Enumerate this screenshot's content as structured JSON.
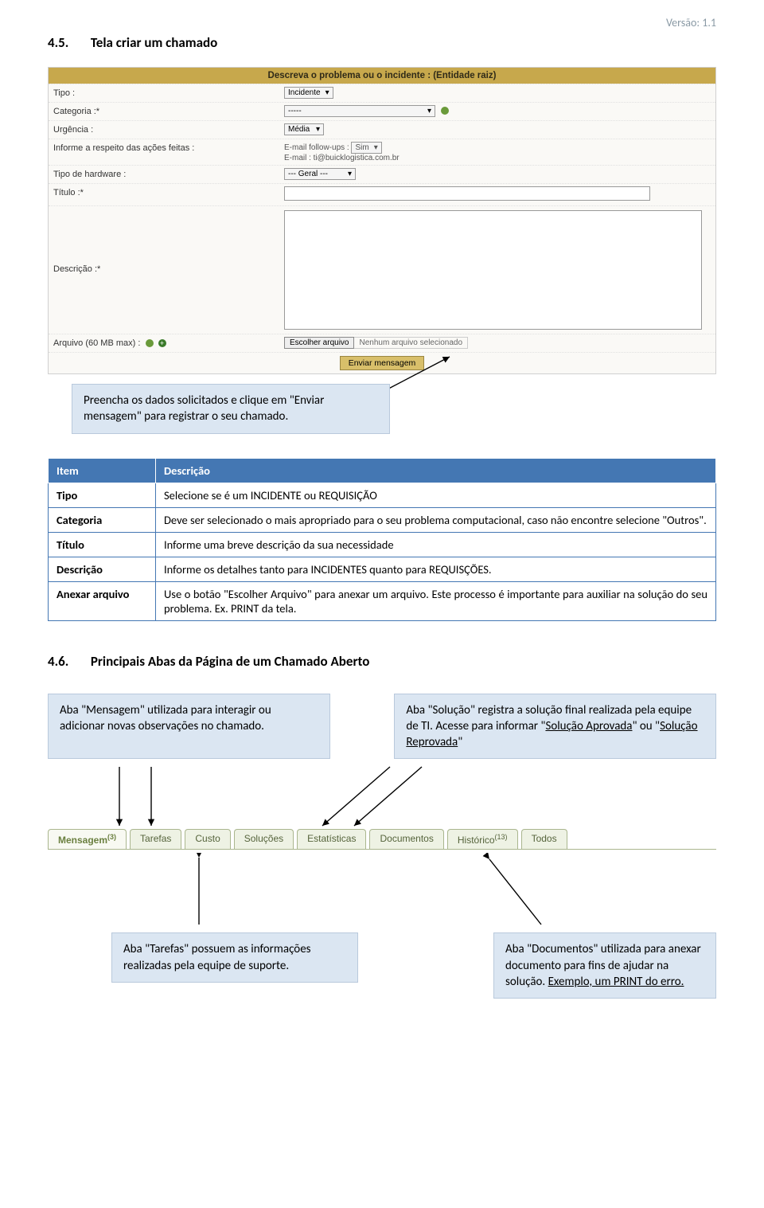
{
  "version_label": "Versão: 1.1",
  "section45_num": "4.5.",
  "section45_title": "Tela criar um chamado",
  "glpi": {
    "header": "Descreva o problema ou o incidente :  (Entidade raiz)",
    "tipo_label": "Tipo :",
    "tipo_value": "Incidente",
    "categoria_label": "Categoria :*",
    "categoria_value": "-----",
    "urgencia_label": "Urgência :",
    "urgencia_value": "Média",
    "info_label": "Informe a respeito das ações feitas :",
    "followup_line": "E-mail follow-ups :",
    "followup_value": "Sim",
    "email_line": "E-mail : ti@buicklogistica.com.br",
    "hw_label": "Tipo de hardware :",
    "hw_value": "--- Geral ---",
    "titulo_label": "Título :*",
    "descricao_label": "Descrição :*",
    "arquivo_label": "Arquivo (60 MB max) :",
    "file_btn": "Escolher arquivo",
    "file_status": "Nenhum arquivo selecionado",
    "send_btn": "Enviar mensagem"
  },
  "callout1": "Preencha os dados solicitados e clique em \"Enviar mensagem\" para registrar o seu chamado.",
  "def_table": {
    "header_item": "Item",
    "header_desc": "Descrição",
    "rows": [
      {
        "k": "Tipo",
        "v": "Selecione se é um INCIDENTE ou REQUISIÇÃO"
      },
      {
        "k": "Categoria",
        "v": "Deve ser selecionado o mais apropriado para o seu problema computacional, caso não encontre selecione \"Outros\"."
      },
      {
        "k": "Título",
        "v": "Informe uma breve descrição da sua necessidade"
      },
      {
        "k": "Descrição",
        "v": "Informe os detalhes tanto para INCIDENTES quanto para REQUISÇÕES."
      },
      {
        "k": "Anexar arquivo",
        "v": "Use o botão \"Escolher Arquivo\" para anexar um arquivo. Este processo é importante para auxiliar na solução do seu problema. Ex. PRINT da tela."
      }
    ]
  },
  "section46_num": "4.6.",
  "section46_title": "Principais Abas da Página de um Chamado Aberto",
  "c_msg": "Aba \"Mensagem\" utilizada para interagir ou adicionar novas observações no chamado.",
  "c_sol_1": "Aba \"Solução\" registra a solução final realizada pela equipe de TI. Acesse para informar \"",
  "c_sol_u1": "Solução Aprovada",
  "c_sol_mid": "\" ou \"",
  "c_sol_u2": "Solução Reprovada",
  "c_sol_end": "\"",
  "tabs": {
    "mensagem": "Mensagem",
    "mensagem_sup": "(3)",
    "tarefas": "Tarefas",
    "custo": "Custo",
    "solucoes": "Soluções",
    "estatisticas": "Estatísticas",
    "documentos": "Documentos",
    "historico": "Histórico",
    "historico_sup": "(13)",
    "todos": "Todos"
  },
  "c_tar": "Aba \"Tarefas\" possuem as informações realizadas pela equipe de suporte.",
  "c_doc_1": "Aba \"Documentos\" utilizada para anexar documento para fins de ajudar na solução. ",
  "c_doc_u": "Exemplo, um PRINT do erro."
}
